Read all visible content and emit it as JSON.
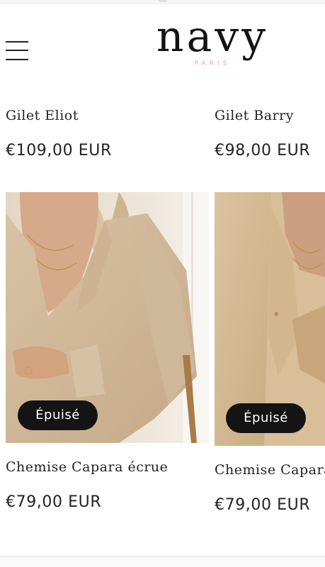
{
  "header": {
    "logo_main": "navy",
    "logo_sub": "PARIS",
    "menu_icon": "hamburger-menu-icon"
  },
  "products_top": [
    {
      "name": "Gilet Eliot",
      "price": "€109,00 EUR"
    },
    {
      "name": "Gilet Barry",
      "price": "€98,00 EUR"
    }
  ],
  "products": [
    {
      "name": "Chemise Capara écrue",
      "price": "€79,00 EUR",
      "badge": "Épuisé"
    },
    {
      "name": "Chemise Capara",
      "price": "€79,00 EUR",
      "badge": "Épuisé"
    }
  ],
  "colors": {
    "badge_bg": "#141414",
    "logo_accent": "#e7a2b2",
    "text": "#1d1d1d"
  }
}
